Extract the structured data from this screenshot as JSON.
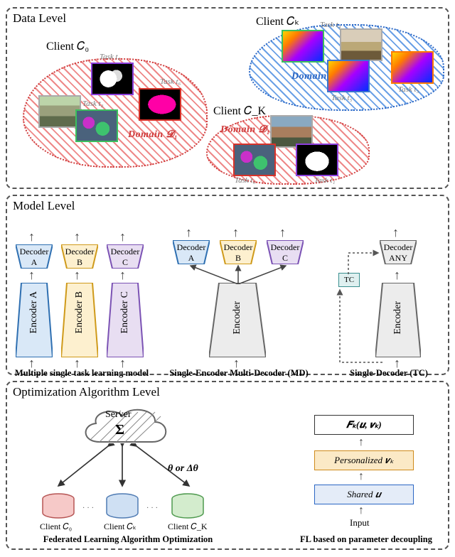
{
  "panels": {
    "data": {
      "title": "Data Level"
    },
    "model": {
      "title": "Model Level"
    },
    "opt": {
      "title": "Optimization Algorithm Level"
    }
  },
  "data_level": {
    "clients": {
      "c0": {
        "label": "Client 𝐶₀"
      },
      "ck": {
        "label": "Client 𝐶ₖ"
      },
      "cK": {
        "label": "Client 𝐶_K"
      }
    },
    "domains": {
      "d1": {
        "label": "Domain 𝓓₁",
        "color": "#cf3b3b"
      },
      "d2": {
        "label": "Domain 𝓓₂",
        "color": "#2a66c4"
      }
    },
    "tasks": {
      "t1": "Task t₁",
      "t2": "Task t₂",
      "t3": "Task t₃",
      "t4": "Task t₄",
      "t5": "Task t₅",
      "t6": "Task t₆"
    }
  },
  "model_level": {
    "encoders": {
      "a": "Encoder A",
      "b": "Encoder B",
      "c": "Encoder C",
      "shared": "Encoder"
    },
    "decoders": {
      "a": "Decoder A",
      "b": "Decoder B",
      "c": "Decoder C",
      "any": "Decoder ANY"
    },
    "tc": "TC",
    "captions": {
      "multi": "Multiple single task learning model",
      "md": "Single-Encoder Multi-Decoder (MD)",
      "tc": "Single-Decoder (TC)"
    }
  },
  "opt_level": {
    "server": "Server",
    "sum": "Σ",
    "theta": "θ or Δθ",
    "clients": {
      "c0": "Client 𝐶₀",
      "ck": "Client 𝐶ₖ",
      "cK": "Client 𝐶_K"
    },
    "input": "Input",
    "shared": "Shared  𝒖",
    "personalized": "Personalized  𝒗ₖ",
    "fk": "𝑭ₖ(𝒖, 𝒗ₖ)",
    "captions": {
      "left": "Federated Learning Algorithm Optimization",
      "right": "FL based on parameter decoupling"
    }
  }
}
